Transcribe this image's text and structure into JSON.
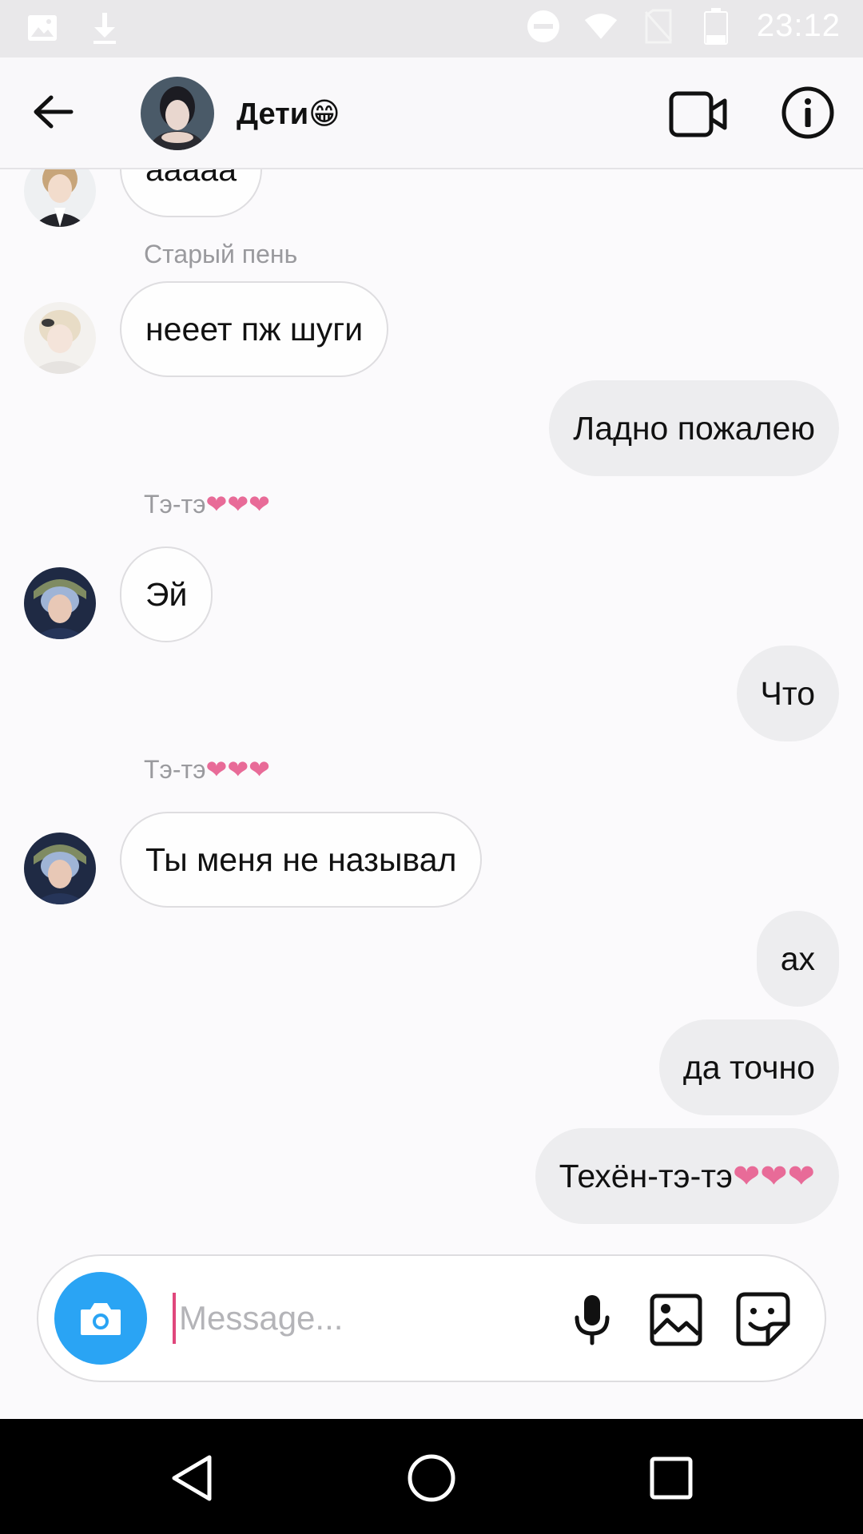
{
  "status_bar": {
    "time": "23:12",
    "left_icons": [
      "gallery-icon",
      "download-icon"
    ],
    "right_icons": [
      "do-not-disturb-icon",
      "wifi-icon",
      "no-sim-icon",
      "battery-icon"
    ]
  },
  "header": {
    "title": "Дети😁",
    "avatar": "group-avatar"
  },
  "messages": [
    {
      "direction": "in",
      "text": "ааааа",
      "avatar": "avatar-1"
    },
    {
      "direction": "in",
      "sender": "Старый пень",
      "text": "нееет пж шуги",
      "avatar": "avatar-2"
    },
    {
      "direction": "out",
      "text": "Ладно пожалею"
    },
    {
      "direction": "in",
      "sender_name": "Тэ-тэ",
      "sender_hearts": "❤❤❤",
      "text": "Эй",
      "avatar": "avatar-3"
    },
    {
      "direction": "out",
      "text": "Что"
    },
    {
      "direction": "in",
      "sender_name": "Тэ-тэ",
      "sender_hearts": "❤❤❤",
      "text": "Ты меня не называл",
      "avatar": "avatar-3"
    },
    {
      "direction": "out",
      "text": "ах"
    },
    {
      "direction": "out",
      "text": "да точно"
    },
    {
      "direction": "out",
      "text_main": "Техён-тэ-тэ",
      "text_hearts": "❤❤❤"
    }
  ],
  "composer": {
    "placeholder": "Message...",
    "value": ""
  },
  "colors": {
    "accent_blue": "#2aa4f4",
    "heart_pink": "#e86b98",
    "cursor_pink": "#e0477c"
  }
}
